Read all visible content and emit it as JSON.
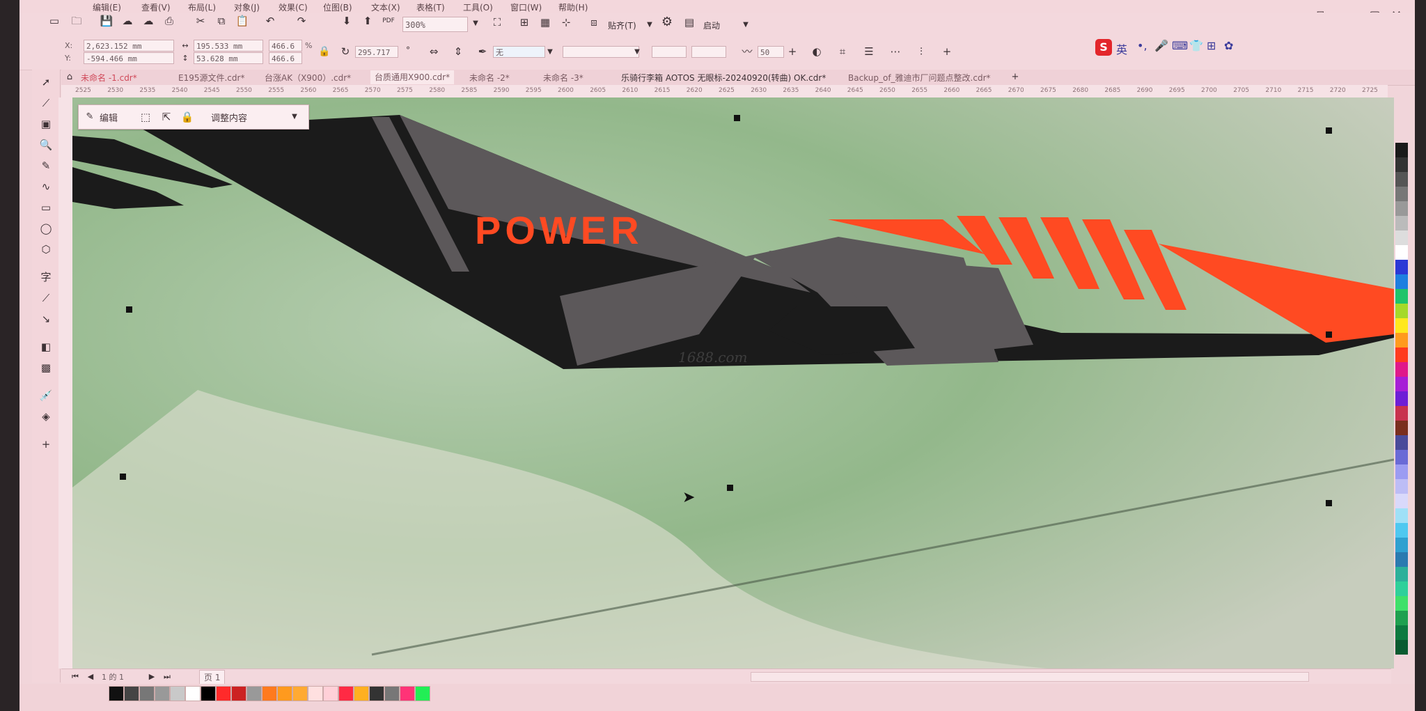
{
  "menu": [
    "编辑(E)",
    "查看(V)",
    "布局(L)",
    "对象(J)",
    "效果(C)",
    "位图(B)",
    "文本(X)",
    "表格(T)",
    "工具(O)",
    "窗口(W)",
    "帮助(H)"
  ],
  "toolbar": {
    "zoom_value": "300%",
    "snap_label": "贴齐(T)",
    "launch_label": "启动"
  },
  "property_bar": {
    "x_value": "2,623.152 mm",
    "y_value": "-594.466 mm",
    "width_value": "195.533 mm",
    "height_value": "53.628 mm",
    "scale_x": "466.6",
    "scale_y": "466.6",
    "percent": "%",
    "rotation": "295.717",
    "fill_value": "无",
    "outline_width": "50"
  },
  "tabs": [
    {
      "label": "未命名 -1.cdr*"
    },
    {
      "label": "E195源文件.cdr*"
    },
    {
      "label": "台涨AK（X900）.cdr*"
    },
    {
      "label": "台质通用X900.cdr*"
    },
    {
      "label": "未命名 -2*"
    },
    {
      "label": "未命名 -3*"
    },
    {
      "label": "乐骑行李箱 AOTOS 无眼标-20240920(转曲) OK.cdr*"
    },
    {
      "label": "Backup_of_雅迪市厂问题点整改.cdr*"
    }
  ],
  "ruler_ticks": [
    "2525",
    "2530",
    "2535",
    "2540",
    "2545",
    "2550",
    "2555",
    "2560",
    "2565",
    "2570",
    "2575",
    "2580",
    "2585",
    "2590",
    "2595",
    "2600",
    "2605",
    "2610",
    "2615",
    "2620",
    "2625",
    "2630",
    "2635",
    "2640",
    "2645",
    "2650",
    "2655",
    "2660",
    "2665",
    "2670",
    "2675",
    "2680",
    "2685",
    "2690",
    "2695",
    "2700",
    "2705",
    "2710",
    "2715",
    "2720",
    "2725"
  ],
  "edit_popup": {
    "edit_label": "编辑",
    "adjust_label": "调整内容"
  },
  "artwork": {
    "power_text": "POWER",
    "watermark": "1688.com"
  },
  "ime": {
    "label": "英"
  },
  "pagebar": {
    "page_label": "页 1",
    "page_count": "1 的 1"
  },
  "colors": {
    "canvas_green": "#9fbf98",
    "black_panel": "#1b1b1b",
    "gray_panel": "#5c585a",
    "orange": "#ff4a22",
    "ui_pink": "#f3d8dd"
  },
  "palette_colors": [
    "#1a1a1a",
    "#333333",
    "#555555",
    "#777777",
    "#999999",
    "#bbbbbb",
    "#dddddd",
    "#ffffff",
    "#2b38d6",
    "#1e7fe0",
    "#1fc46b",
    "#a5d92a",
    "#ffe81e",
    "#ff9b1e",
    "#ff3a1e",
    "#e0198a",
    "#a71ed6",
    "#6e1ed6",
    "#c8324e",
    "#7a2e1e",
    "#4a4a9a",
    "#6a6ad6",
    "#9c9cf2",
    "#bdbdf6",
    "#d9d9fb",
    "#9fe0f7",
    "#4fc8f0",
    "#2fa0d0",
    "#2a7ab0",
    "#2cb09a",
    "#2fd09a",
    "#3fe06a",
    "#1fa050",
    "#0d7a40",
    "#0a5a30"
  ],
  "bottom_palette": [
    "#111111",
    "#444444",
    "#777777",
    "#999999",
    "#c9c9c9",
    "#ffffff",
    "#000000",
    "#ff2a2a",
    "#cc2222",
    "#999999",
    "#ff7a1e",
    "#ff9a1e",
    "#ffaa33",
    "#ffe0e0",
    "#ffd0d8",
    "#ff2a44",
    "#ffb020",
    "#333333",
    "#777777",
    "#ff3377",
    "#22ee55"
  ]
}
